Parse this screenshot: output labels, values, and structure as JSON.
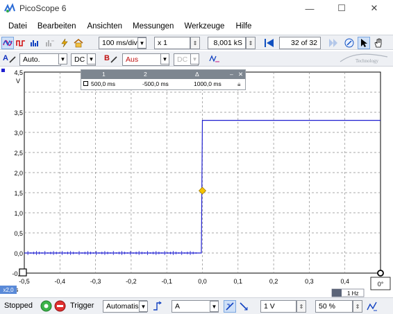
{
  "window": {
    "title": "PicoScope 6",
    "minimize": "—",
    "maximize": "☐",
    "close": "✕"
  },
  "menu": [
    "Datei",
    "Bearbeiten",
    "Ansichten",
    "Messungen",
    "Werkzeuge",
    "Hilfe"
  ],
  "toolbar": {
    "timebase": "100 ms/div",
    "zoom": "x 1",
    "samples": "8,001 kS",
    "buffer": "32 of 32",
    "logo_text": "Technology"
  },
  "channels": {
    "a": {
      "label": "A",
      "range": "Auto.",
      "coupling": "DC"
    },
    "b": {
      "label": "B",
      "range": "Aus",
      "coupling": "DC"
    }
  },
  "ruler": {
    "headers": [
      "1",
      "2",
      "Δ"
    ],
    "values": [
      "500,0 ms",
      "-500,0 ms",
      "1000,0 ms"
    ]
  },
  "chart_data": {
    "type": "line",
    "ylabel": "V",
    "y_ticks": [
      "4,5",
      "3,5",
      "3,0",
      "2,5",
      "2,0",
      "1,5",
      "1,0",
      "0,5",
      "0,0",
      "-0,5"
    ],
    "x_ticks": [
      "-0,5",
      "-0,4",
      "-0,3",
      "-0,2",
      "-0,1",
      "0,0",
      "0,1",
      "0,2",
      "0,3",
      "0,4"
    ],
    "xlabel": "s",
    "xlim": [
      -0.5,
      0.5
    ],
    "ylim": [
      -0.5,
      4.5
    ],
    "grid": true,
    "series": [
      {
        "color": "#1f1fd0",
        "x": [
          -0.5,
          -0.003,
          0.0,
          0.5
        ],
        "y": [
          0.0,
          0.0,
          3.3,
          3.3
        ]
      }
    ],
    "trigger_marker": {
      "x": 0.0,
      "y": 1.55
    },
    "zoom_badge": "x2,0",
    "freq_badge": "1 Hz"
  },
  "status": {
    "state": "Stopped",
    "trigger_label": "Trigger",
    "trigger_mode": "Automatis",
    "trigger_channel": "A",
    "threshold": "1 V",
    "pretrigger": "50 %"
  },
  "colors": {
    "trace": "#1f1fd0",
    "trigger": "#f5c400",
    "toolbar_bg": "#eef0f4"
  }
}
